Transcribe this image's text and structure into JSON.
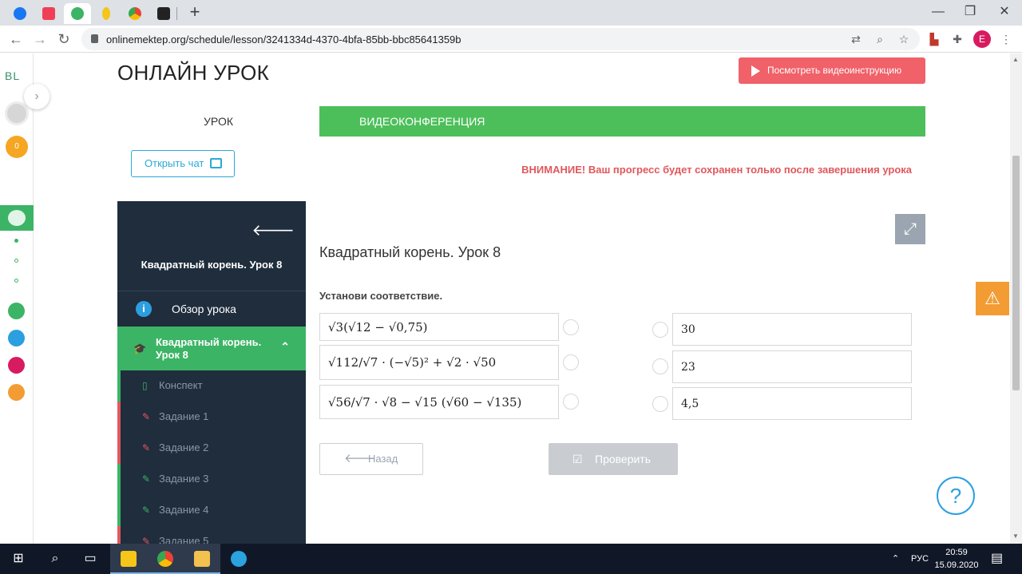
{
  "browser": {
    "url": "onlinemektep.org/schedule/lesson/3241334d-4370-4bfa-85bb-bbc85641359b",
    "tabs": [
      {
        "name": "facebook",
        "color": "#1877f2"
      },
      {
        "name": "pocket",
        "color": "#ef3f56"
      },
      {
        "name": "bilimland",
        "color": "#3cb465"
      },
      {
        "name": "lamp",
        "color": "#f5c518"
      },
      {
        "name": "chrome",
        "color": "#34a853"
      },
      {
        "name": "notes",
        "color": "#222222"
      }
    ],
    "new_tab": "+",
    "window_controls": {
      "minimize": "—",
      "maximize": "❐",
      "close": "✕"
    },
    "profile_initial": "E"
  },
  "rail": {
    "logo": "BL",
    "coins": "0"
  },
  "page": {
    "title": "ОНЛАЙН УРОК",
    "video_button": "Посмотреть видеоинструкцию",
    "tabs": {
      "lesson": "УРОК",
      "video": "ВИДЕОКОНФЕРЕНЦИЯ"
    },
    "chat_button": "Открыть чат",
    "warning": "ВНИМАНИЕ! Ваш прогресс будет сохранен только после завершения урока"
  },
  "sidenav": {
    "title": "Квадратный корень. Урок 8",
    "overview": "Обзор урока",
    "current": "Квадратный корень. Урок 8",
    "items": [
      {
        "label": "Конспект",
        "status": "done",
        "bar": "#3cb465"
      },
      {
        "label": "Задание 1",
        "status": "todo",
        "bar": "#e0585d"
      },
      {
        "label": "Задание 2",
        "status": "todo",
        "bar": "#e0585d"
      },
      {
        "label": "Задание 3",
        "status": "done",
        "bar": "#3cb465"
      },
      {
        "label": "Задание 4",
        "status": "done",
        "bar": "#3cb465"
      },
      {
        "label": "Задание 5",
        "status": "todo",
        "bar": "#e0585d"
      }
    ]
  },
  "task": {
    "lesson_title": "Квадратный корень. Урок 8",
    "instruction": "Установи соответствие.",
    "expressions": [
      "√3(√12 − √0,75)",
      "√112/√7 · (−√5)² + √2 · √50",
      "√56/√7 · √8 − √15 (√60 − √135)"
    ],
    "answers": [
      "30",
      "23",
      "4,5"
    ],
    "back_button": "Назад",
    "check_button": "Проверить"
  },
  "taskbar": {
    "lang": "РУС",
    "time": "20:59",
    "date": "15.09.2020"
  },
  "colors": {
    "accent_green": "#4cbf5a",
    "warning_red": "#e0585d",
    "nav_dark": "#1f2d3d",
    "info_blue": "#2b9fe0"
  }
}
